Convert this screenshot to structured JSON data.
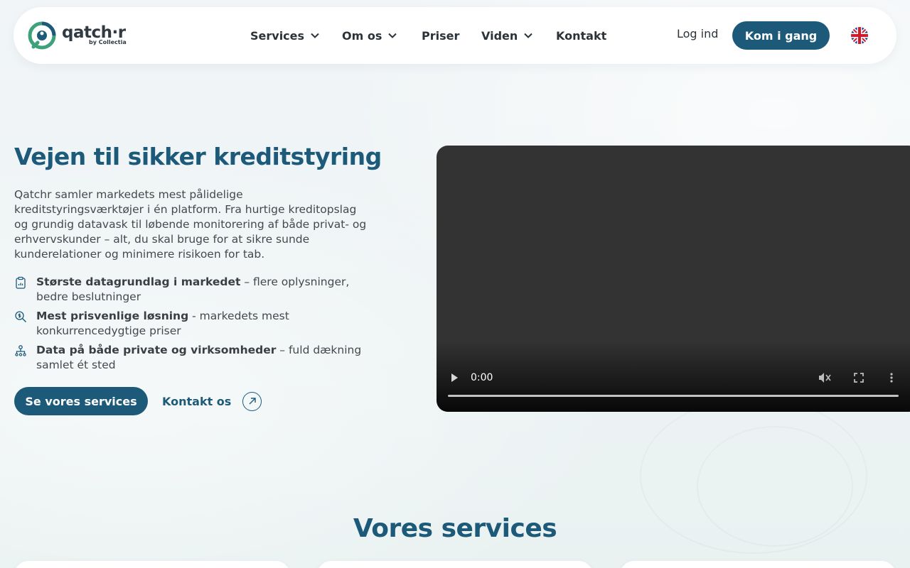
{
  "brand": {
    "name": "qatch·r",
    "sub": "by Collectia",
    "accent": "#1d5a7a",
    "logo_green": "#3da17a"
  },
  "nav": {
    "items": [
      {
        "label": "Services",
        "has_dropdown": true
      },
      {
        "label": "Om os",
        "has_dropdown": true
      },
      {
        "label": "Priser",
        "has_dropdown": false
      },
      {
        "label": "Viden",
        "has_dropdown": true
      },
      {
        "label": "Kontakt",
        "has_dropdown": false
      }
    ],
    "login": "Log ind",
    "cta": "Kom i gang",
    "language_icon": "uk-flag-icon"
  },
  "hero": {
    "title": "Vejen til sikker kreditstyring",
    "lead": "Qatchr samler markedets mest pålidelige kreditstyringsværktøjer i én platform. Fra hurtige kreditopslag og grundig datavask til løbende monitorering af både privat- og erhvervskunder – alt, du skal bruge for at sikre sunde kunderelationer og minimere risikoen for tab.",
    "features": [
      {
        "icon": "clipboard-chart-icon",
        "bold": "Største datagrundlag i markedet",
        "rest": " – flere oplysninger, bedre beslutninger"
      },
      {
        "icon": "price-search-icon",
        "bold": "Mest prisvenlige løsning",
        "rest": " - markedets mest konkurrencedygtige priser"
      },
      {
        "icon": "org-chart-icon",
        "bold": "Data på både private og virksomheder",
        "rest": " – fuld dækning samlet ét sted"
      }
    ],
    "primary_button": "Se vores services",
    "secondary_button": "Kontakt os"
  },
  "video": {
    "time": "0:00",
    "progress": 0
  },
  "services": {
    "title": "Vores services"
  }
}
